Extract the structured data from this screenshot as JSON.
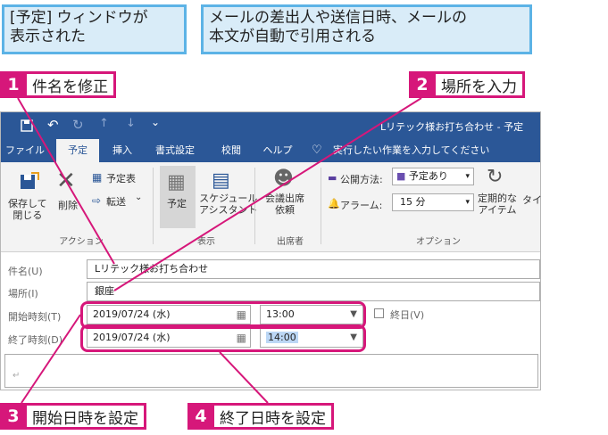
{
  "callouts": {
    "left": [
      "[予定] ウィンドウが",
      "表示された"
    ],
    "right": [
      "メールの差出人や送信日時、メールの",
      "本文が自動で引用される"
    ]
  },
  "steps": [
    {
      "num": "1",
      "label": "件名を修正"
    },
    {
      "num": "2",
      "label": "場所を入力"
    },
    {
      "num": "3",
      "label": "開始日時を設定"
    },
    {
      "num": "4",
      "label": "終了日時を設定"
    }
  ],
  "window": {
    "title": "Lリテック様お打ち合わせ - 予定",
    "tabs": [
      "ファイル",
      "予定",
      "挿入",
      "書式設定",
      "校閲",
      "ヘルプ"
    ],
    "tell_me": "実行したい作業を入力してください"
  },
  "ribbon": {
    "save_close": [
      "保存して",
      "閉じる"
    ],
    "delete": "削除",
    "calendar": "予定表",
    "forward": "転送",
    "group_action": "アクション",
    "appointment": "予定",
    "scheduling": [
      "スケジュール",
      "アシスタント"
    ],
    "group_show": "表示",
    "meeting": [
      "会議出席",
      "依頼"
    ],
    "group_attendees": "出席者",
    "show_as_label": "公開方法:",
    "show_as_value": "予定あり",
    "reminder_label": "アラーム:",
    "reminder_value": "15 分",
    "recurrence": [
      "定期的な",
      "アイテム"
    ],
    "timezone": "タイ",
    "group_options": "オプション"
  },
  "form": {
    "subject_label": "件名(U)",
    "subject_value": "Lリテック様お打ち合わせ",
    "location_label": "場所(I)",
    "location_value": "銀座",
    "start_label": "開始時刻(T)",
    "start_date": "2019/07/24 (水)",
    "start_time": "13:00",
    "allday_label": "終日(V)",
    "end_label": "終了時刻(D)",
    "end_date": "2019/07/24 (水)",
    "end_time": "14:00",
    "body_mark": "↵"
  },
  "colors": {
    "accent": "#d6177a",
    "callout_border": "#5cb3e6",
    "title_bar": "#2b5797"
  }
}
